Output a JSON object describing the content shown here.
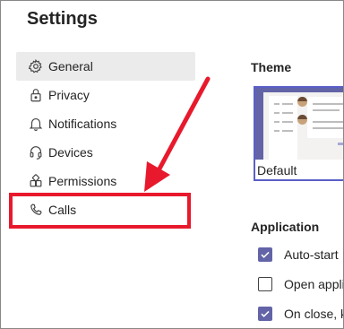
{
  "window": {
    "title": "Settings"
  },
  "sidebar": {
    "items": [
      {
        "label": "General",
        "icon": "gear-icon",
        "active": true
      },
      {
        "label": "Privacy",
        "icon": "lock-icon",
        "active": false
      },
      {
        "label": "Notifications",
        "icon": "bell-icon",
        "active": false
      },
      {
        "label": "Devices",
        "icon": "headset-icon",
        "active": false
      },
      {
        "label": "Permissions",
        "icon": "permissions-icon",
        "active": false
      },
      {
        "label": "Calls",
        "icon": "phone-icon",
        "active": false
      }
    ]
  },
  "main": {
    "theme": {
      "heading": "Theme",
      "selected_label": "Default"
    },
    "application": {
      "heading": "Application",
      "options": [
        {
          "label": "Auto-start",
          "checked": true
        },
        {
          "label": "Open appli",
          "checked": false
        },
        {
          "label": "On close, k",
          "checked": true
        }
      ]
    }
  },
  "annotation": {
    "highlight_target": "Calls",
    "color": "#e8192c"
  },
  "colors": {
    "accent": "#6264a7",
    "active_bg": "#ebebeb",
    "annotation_red": "#e8192c"
  }
}
